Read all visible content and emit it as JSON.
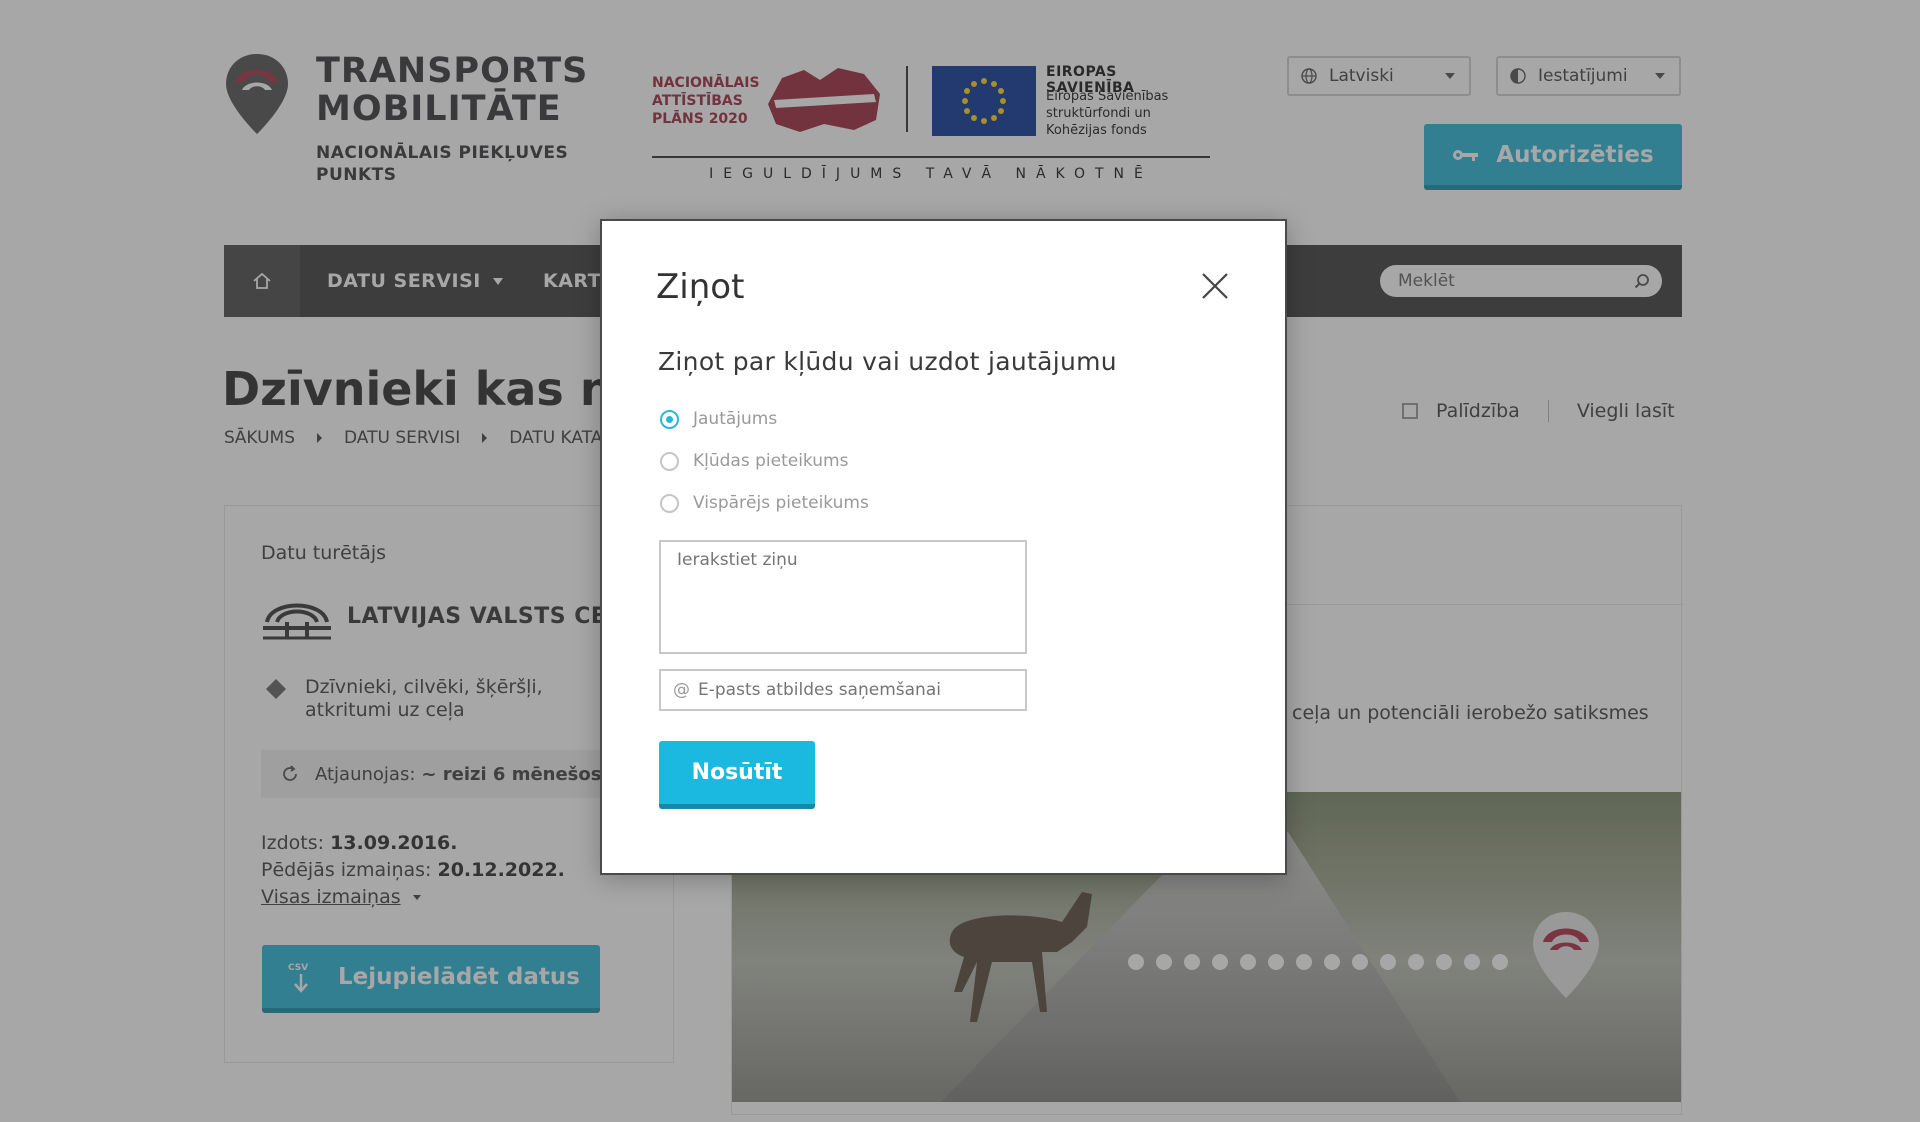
{
  "header": {
    "logo_title": "TRANSPORTS MOBILITĀTE",
    "logo_subtitle": "NACIONĀLAIS PIEKĻUVES PUNKTS",
    "nap_text": "NACIONĀLAIS ATTĪSTĪBAS PLĀNS 2020",
    "eu_title": "EIROPAS SAVIENĪBA",
    "eu_desc": "Eiropas Savienības struktūrfondi un Kohēzijas fonds",
    "eu_motto": "IEGULDĪJUMS TAVĀ NĀKOTNĒ",
    "language": "Latviski",
    "settings": "Iestatījumi",
    "login": "Autorizēties"
  },
  "nav": {
    "items": [
      "DATU SERVISI",
      "KART"
    ],
    "search_placeholder": "Meklēt"
  },
  "page": {
    "title": "Dzīvnieki kas no",
    "breadcrumb": [
      "SĀKUMS",
      "DATU SERVISI",
      "DATU KATA"
    ],
    "help": "Palīdzība",
    "easy_read": "Viegli lasīt"
  },
  "card": {
    "holder_label": "Datu turētājs",
    "holder_name": "LATVIJAS VALSTS CEĻI",
    "category": "Dzīvnieki, cilvēki, šķēršļi, atkritumi uz ceļa",
    "update_label": "Atjaunojas:",
    "update_value": "~ reizi 6 mēnešos",
    "published_label": "Izdots:",
    "published_value": "13.09.2016.",
    "changed_label": "Pēdējās izmaiņas:",
    "changed_value": "20.12.2022.",
    "all_changes": "Visas izmaiņas",
    "download": "Lejupielādēt datus",
    "csv_badge": "CSV"
  },
  "content": {
    "description": "ceļa un potenciāli ierobežo satiksmes"
  },
  "modal": {
    "title": "Ziņot",
    "subtitle": "Ziņot par  kļūdu vai uzdot jautājumu",
    "options": [
      "Jautājums",
      "Kļūdas pieteikums",
      "Vispārējs pieteikums"
    ],
    "selected_option": "Jautājums",
    "message_placeholder": "Ierakstiet ziņu",
    "email_placeholder": "E-pasts atbildes saņemšanai",
    "submit": "Nosūtīt"
  },
  "colors": {
    "accent": "#2ab7d8",
    "brand_red": "#9e2a40",
    "nav_bg": "#3e3e3e"
  }
}
